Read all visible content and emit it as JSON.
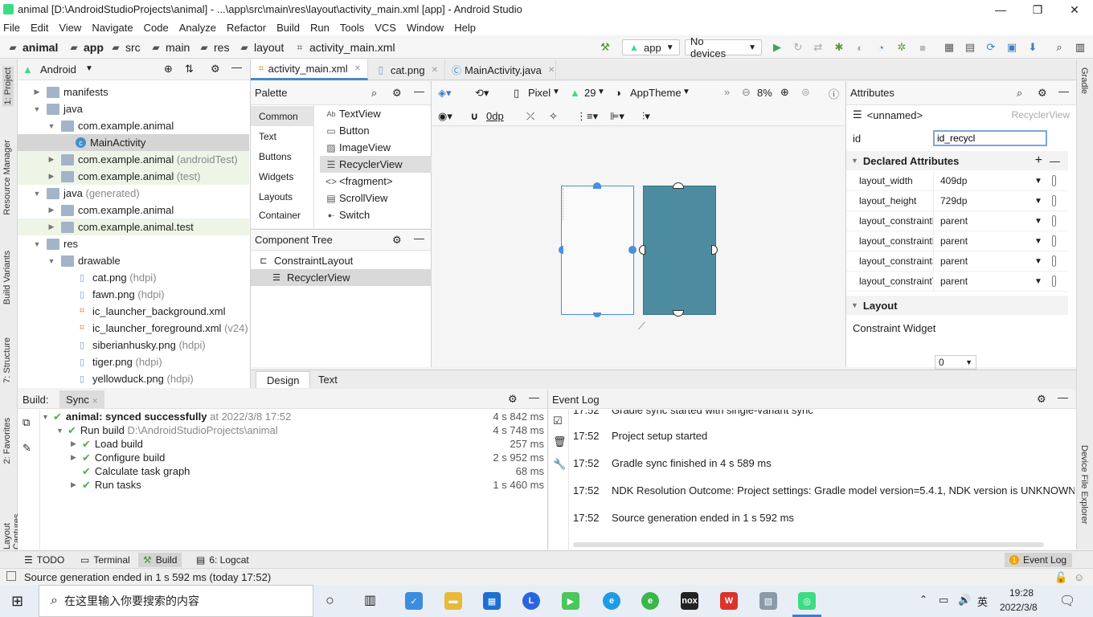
{
  "window": {
    "title": "animal [D:\\AndroidStudioProjects\\animal] - ...\\app\\src\\main\\res\\layout\\activity_main.xml [app] - Android Studio"
  },
  "menu": [
    "File",
    "Edit",
    "View",
    "Navigate",
    "Code",
    "Analyze",
    "Refactor",
    "Build",
    "Run",
    "Tools",
    "VCS",
    "Window",
    "Help"
  ],
  "breadcrumb": [
    "animal",
    "app",
    "src",
    "main",
    "res",
    "layout",
    "activity_main.xml"
  ],
  "toolbar": {
    "config": "app",
    "device": "No devices"
  },
  "left_tabs": [
    "1: Project",
    "Resource Manager",
    "Build Variants",
    "7: Structure",
    "2: Favorites",
    "Layout Captures"
  ],
  "right_tabs": [
    "Gradle",
    "Device File Explorer"
  ],
  "project": {
    "view": "Android",
    "tree": [
      {
        "label": "manifests",
        "extra": ""
      },
      {
        "label": "java",
        "extra": ""
      },
      {
        "label": "com.example.animal",
        "extra": ""
      },
      {
        "label": "MainActivity",
        "extra": ""
      },
      {
        "label": "com.example.animal",
        "extra": "(androidTest)"
      },
      {
        "label": "com.example.animal",
        "extra": "(test)"
      },
      {
        "label": "java",
        "extra": "(generated)"
      },
      {
        "label": "com.example.animal",
        "extra": ""
      },
      {
        "label": "com.example.animal.test",
        "extra": ""
      },
      {
        "label": "res",
        "extra": ""
      },
      {
        "label": "drawable",
        "extra": ""
      },
      {
        "label": "cat.png",
        "extra": "(hdpi)"
      },
      {
        "label": "fawn.png",
        "extra": "(hdpi)"
      },
      {
        "label": "ic_launcher_background.xml",
        "extra": ""
      },
      {
        "label": "ic_launcher_foreground.xml",
        "extra": "(v24)"
      },
      {
        "label": "siberianhusky.png",
        "extra": "(hdpi)"
      },
      {
        "label": "tiger.png",
        "extra": "(hdpi)"
      },
      {
        "label": "yellowduck.png",
        "extra": "(hdpi)"
      }
    ]
  },
  "editor_tabs": [
    "activity_main.xml",
    "cat.png",
    "MainActivity.java"
  ],
  "palette": {
    "title": "Palette",
    "categories": [
      "Common",
      "Text",
      "Buttons",
      "Widgets",
      "Layouts",
      "Container"
    ],
    "items": [
      "TextView",
      "Button",
      "ImageView",
      "RecyclerView",
      "<fragment>",
      "ScrollView",
      "Switch"
    ],
    "item_icons": [
      "Ab",
      "▭",
      "▨",
      "☰",
      "<>",
      "▤",
      "●-"
    ]
  },
  "component_tree": {
    "title": "Component Tree",
    "items": [
      "ConstraintLayout",
      "RecyclerView"
    ]
  },
  "design_toolbar": {
    "device": "Pixel",
    "api": "29",
    "theme": "AppTheme",
    "zoom": "8%",
    "margin": "0dp"
  },
  "attributes": {
    "title": "Attributes",
    "component": "<unnamed>",
    "component_type": "RecyclerView",
    "id_label": "id",
    "id_value": "id_recycl",
    "declared_title": "Declared Attributes",
    "declared": [
      {
        "k": "layout_width",
        "v": "409dp"
      },
      {
        "k": "layout_height",
        "v": "729dp"
      },
      {
        "k": "layout_constraintE",
        "v": "parent"
      },
      {
        "k": "layout_constraintE",
        "v": "parent"
      },
      {
        "k": "layout_constraintS",
        "v": "parent"
      },
      {
        "k": "layout_constraintT",
        "v": "parent"
      }
    ],
    "layout_title": "Layout",
    "constraint_widget": "Constraint Widget",
    "margin_value": "0"
  },
  "design_tabs": [
    "Design",
    "Text"
  ],
  "build": {
    "tabs": [
      "Build:",
      "Sync"
    ],
    "rows": [
      {
        "label": "animal: synced successfully",
        "extra": "at 2022/3/8 17:52",
        "time": "4 s 842 ms"
      },
      {
        "label": "Run build",
        "extra": "D:\\AndroidStudioProjects\\animal",
        "time": "4 s 748 ms"
      },
      {
        "label": "Load build",
        "extra": "",
        "time": "257 ms"
      },
      {
        "label": "Configure build",
        "extra": "",
        "time": "2 s 952 ms"
      },
      {
        "label": "Calculate task graph",
        "extra": "",
        "time": "68 ms"
      },
      {
        "label": "Run tasks",
        "extra": "",
        "time": "1 s 460 ms"
      }
    ]
  },
  "event_log": {
    "title": "Event Log",
    "rows": [
      {
        "time": "17:52",
        "msg": "Gradle sync started with single-variant sync"
      },
      {
        "time": "17:52",
        "msg": "Project setup started"
      },
      {
        "time": "17:52",
        "msg": "Gradle sync finished in 4 s 589 ms"
      },
      {
        "time": "17:52",
        "msg": "NDK Resolution Outcome: Project settings: Gradle model version=5.4.1, NDK version is UNKNOWN"
      },
      {
        "time": "17:52",
        "msg": "Source generation ended in 1 s 592 ms"
      }
    ]
  },
  "bottom_tabs": [
    "TODO",
    "Terminal",
    "Build",
    "6: Logcat"
  ],
  "event_log_tab": {
    "count": "1",
    "label": "Event Log"
  },
  "status": "Source generation ended in 1 s 592 ms (today 17:52)",
  "taskbar": {
    "search": "在这里输入你要搜索的内容",
    "lang": "英",
    "time": "19:28",
    "date": "2022/3/8"
  }
}
